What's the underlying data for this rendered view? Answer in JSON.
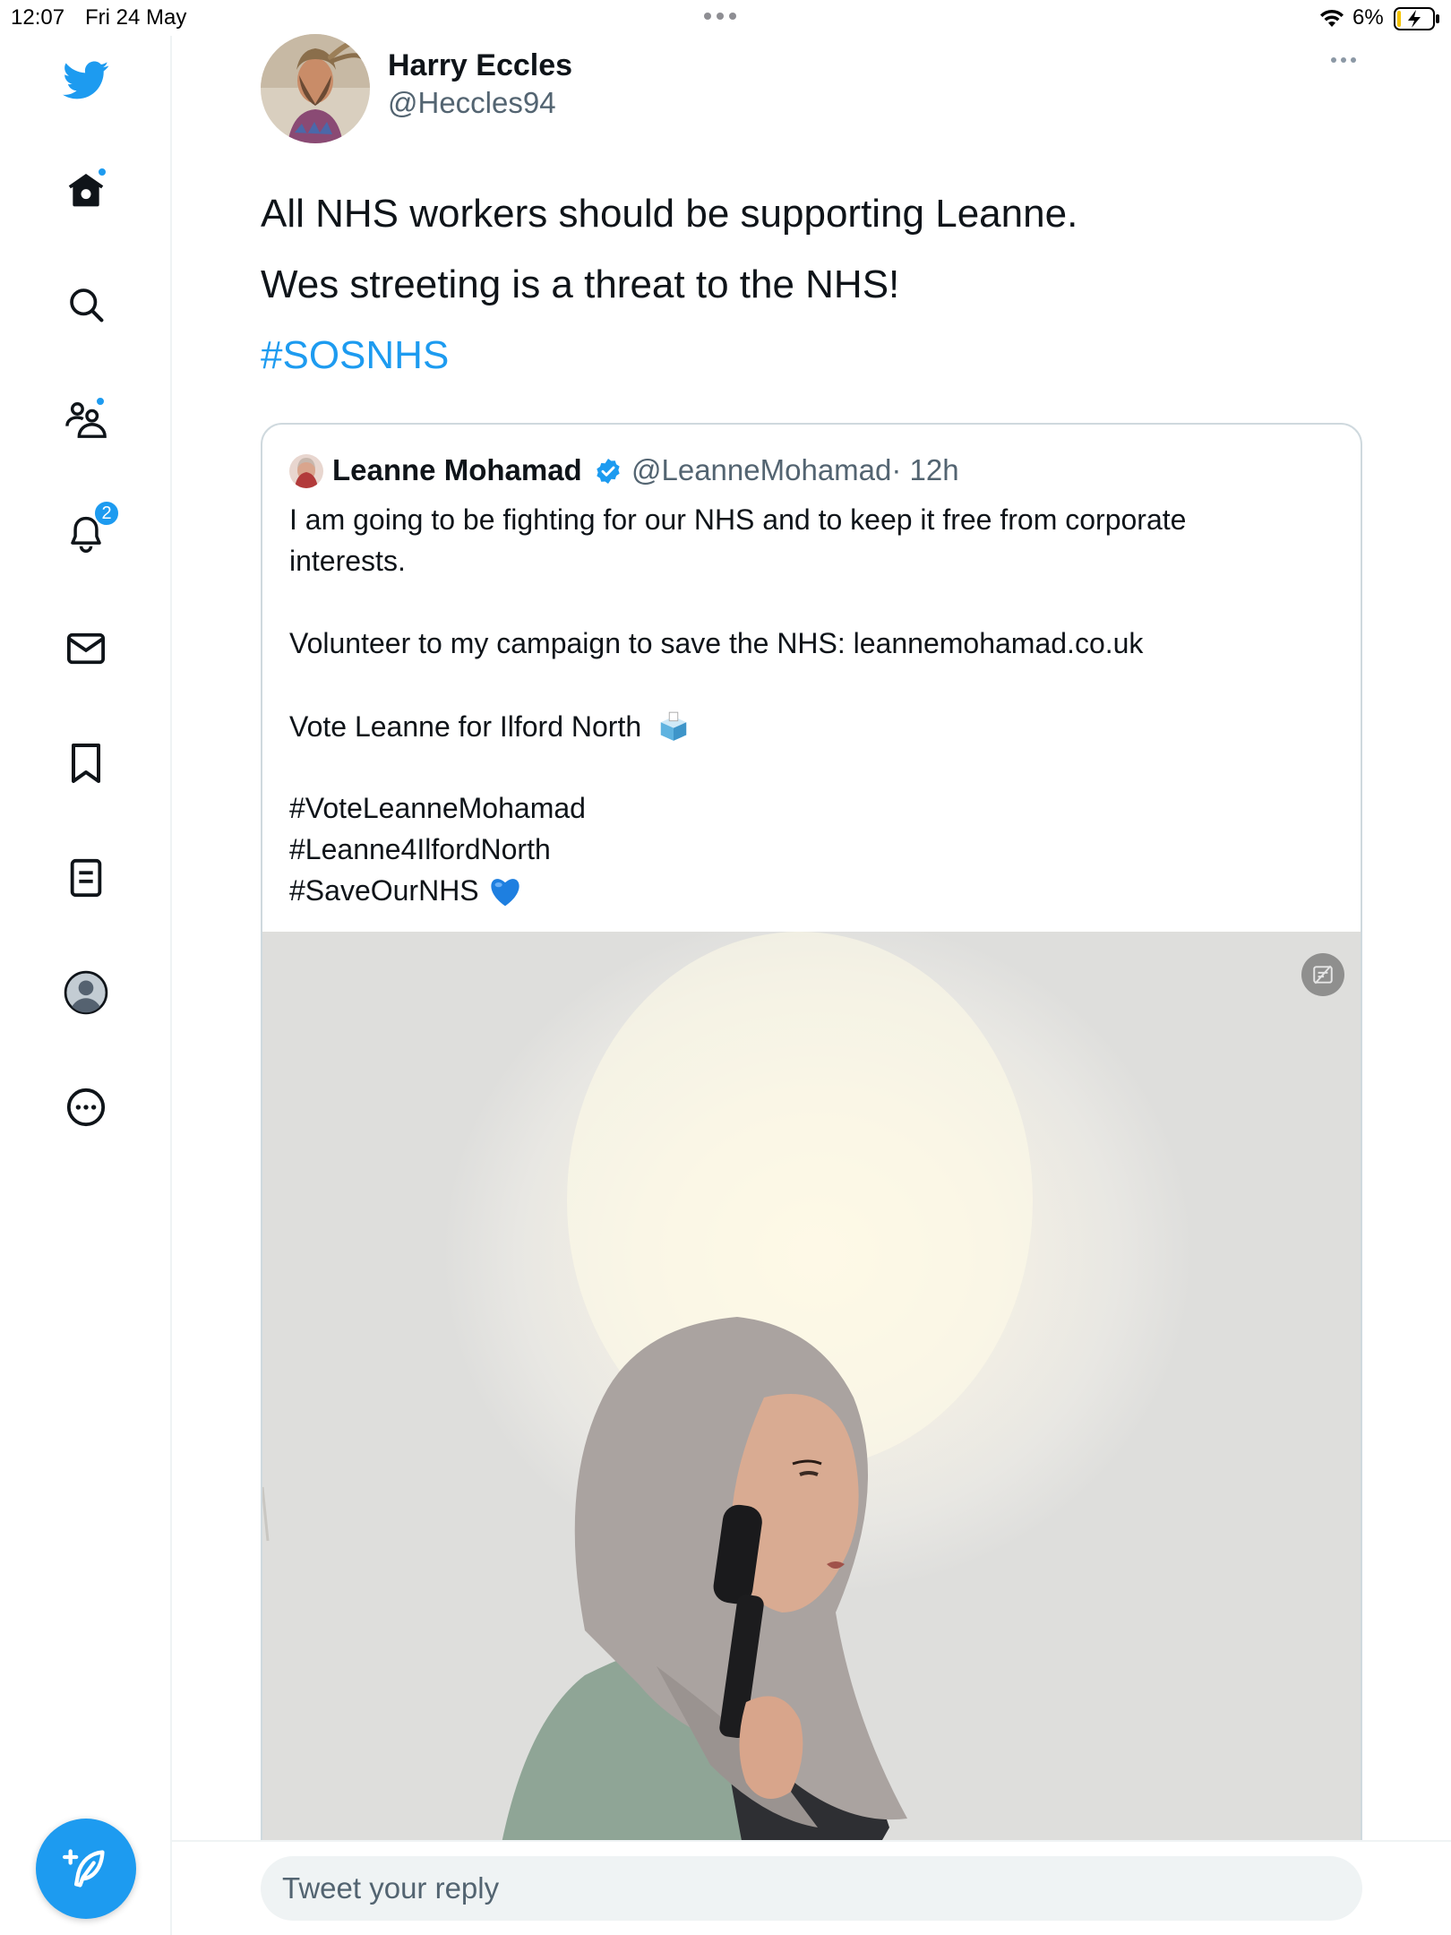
{
  "status_bar": {
    "time": "12:07",
    "date": "Fri 24 May",
    "battery": "6%"
  },
  "sidebar": {
    "items": [
      {
        "name": "home",
        "icon": "home-icon",
        "has_dot": true
      },
      {
        "name": "explore",
        "icon": "search-icon"
      },
      {
        "name": "communities",
        "icon": "communities-icon",
        "has_dot": true
      },
      {
        "name": "notifications",
        "icon": "bell-icon",
        "badge": "2"
      },
      {
        "name": "messages",
        "icon": "mail-icon"
      },
      {
        "name": "bookmarks",
        "icon": "bookmark-icon"
      },
      {
        "name": "lists",
        "icon": "lists-icon"
      },
      {
        "name": "profile",
        "icon": "profile-icon"
      },
      {
        "name": "more",
        "icon": "more-circle-icon"
      }
    ],
    "compose_icon": "compose-tweet-icon"
  },
  "tweet": {
    "author_name": "Harry Eccles",
    "author_handle": "@Heccles94",
    "line1": "All NHS workers should be supporting Leanne.",
    "line2": "Wes streeting is a threat to the NHS!",
    "hashtag": "#SOSNHS"
  },
  "quoted_tweet": {
    "author_name": "Leanne Mohamad",
    "author_handle": "@LeanneMohamad",
    "time": "· 12h",
    "line1": "I am going to be fighting for our NHS and to keep it free from corporate",
    "line2": "interests.",
    "line3_prefix": "Volunteer to my campaign to save the NHS: ",
    "link": "leannemohamad.co.uk",
    "line4": "Vote Leanne for Ilford North",
    "hashtag1": "#VoteLeanneMohamad",
    "hashtag2": "#Leanne4IlfordNorth",
    "hashtag3": "#SaveOurNHS",
    "emoji_ballot": "ballot-box-emoji",
    "emoji_heart": "blue-heart-emoji"
  },
  "reply": {
    "placeholder": "Tweet your reply"
  },
  "colors": {
    "accent": "#1d9bf0",
    "text": "#0f1419",
    "secondary": "#536471",
    "border": "#cfd9de"
  }
}
